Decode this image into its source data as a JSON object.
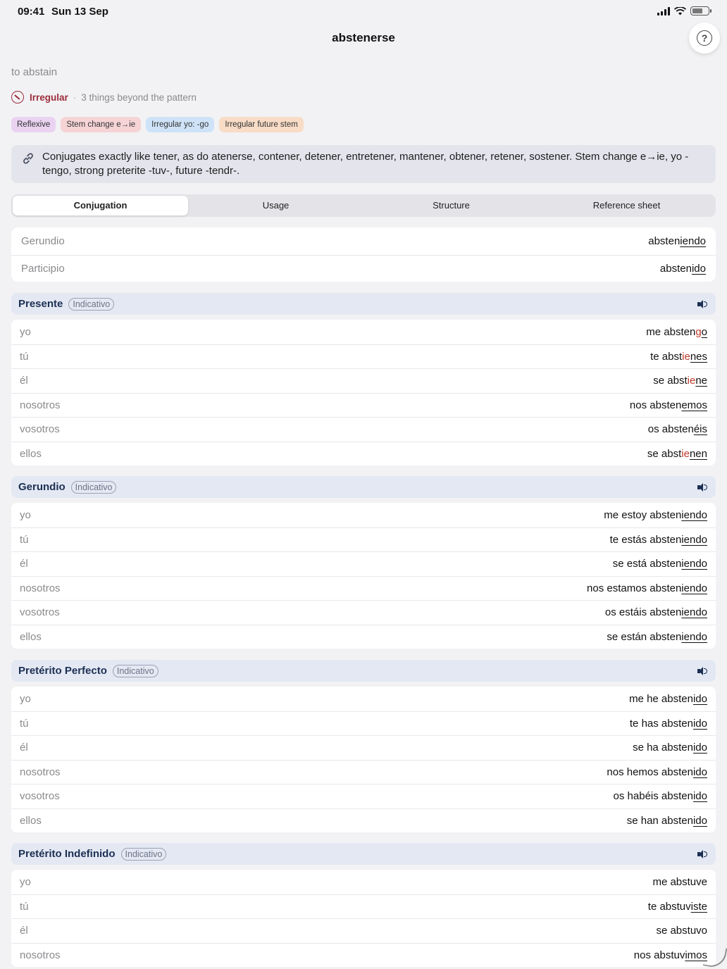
{
  "status": {
    "time": "09:41",
    "date": "Sun 13 Sep"
  },
  "nav": {
    "title": "abstenerse"
  },
  "verb": {
    "translation": "to abstain",
    "irregular_label": "Irregular",
    "irregular_note": "3 things beyond the pattern",
    "info": "Conjugates exactly like tener, as do atenerse, contener, detener, entretener, mantener, obtener, retener, sostener. Stem change e→ie, yo -tengo, strong preterite -tuv-, future -tendr-."
  },
  "tags": [
    {
      "label": "Reflexive",
      "color": "#ead2f1"
    },
    {
      "label": "Stem change e→ie",
      "color": "#f6d4d6"
    },
    {
      "label": "Irregular yo: -go",
      "color": "#cfe3f8"
    },
    {
      "label": "Irregular future stem",
      "color": "#f8dcc6"
    }
  ],
  "tabs": [
    "Conjugation",
    "Usage",
    "Structure",
    "Reference sheet"
  ],
  "forms": [
    {
      "label": "Gerundio",
      "stem": "absten",
      "ending": "iendo"
    },
    {
      "label": "Participio",
      "stem": "absten",
      "ending": "ido"
    }
  ],
  "sections": [
    {
      "title": "Presente",
      "mood": "Indicativo",
      "rows": [
        {
          "pronoun": "yo",
          "parts": [
            [
              "me absten",
              ""
            ],
            [
              "g",
              "chg"
            ],
            [
              "o",
              "end"
            ]
          ]
        },
        {
          "pronoun": "tú",
          "parts": [
            [
              "te abst",
              ""
            ],
            [
              "ie",
              "chg"
            ],
            [
              "nes",
              "end"
            ]
          ]
        },
        {
          "pronoun": "él",
          "parts": [
            [
              "se abst",
              ""
            ],
            [
              "ie",
              "chg"
            ],
            [
              "ne",
              "end"
            ]
          ]
        },
        {
          "pronoun": "nosotros",
          "parts": [
            [
              "nos absten",
              ""
            ],
            [
              "emos",
              "end"
            ]
          ]
        },
        {
          "pronoun": "vosotros",
          "parts": [
            [
              "os absten",
              ""
            ],
            [
              "éis",
              "end"
            ]
          ]
        },
        {
          "pronoun": "ellos",
          "parts": [
            [
              "se abst",
              ""
            ],
            [
              "ie",
              "chg"
            ],
            [
              "nen",
              "end"
            ]
          ]
        }
      ]
    },
    {
      "title": "Gerundio",
      "mood": "Indicativo",
      "rows": [
        {
          "pronoun": "yo",
          "parts": [
            [
              "me estoy absten",
              ""
            ],
            [
              "iendo",
              "end"
            ]
          ]
        },
        {
          "pronoun": "tú",
          "parts": [
            [
              "te estás absten",
              ""
            ],
            [
              "iendo",
              "end"
            ]
          ]
        },
        {
          "pronoun": "él",
          "parts": [
            [
              "se está absten",
              ""
            ],
            [
              "iendo",
              "end"
            ]
          ]
        },
        {
          "pronoun": "nosotros",
          "parts": [
            [
              "nos estamos absten",
              ""
            ],
            [
              "iendo",
              "end"
            ]
          ]
        },
        {
          "pronoun": "vosotros",
          "parts": [
            [
              "os estáis absten",
              ""
            ],
            [
              "iendo",
              "end"
            ]
          ]
        },
        {
          "pronoun": "ellos",
          "parts": [
            [
              "se están absten",
              ""
            ],
            [
              "iendo",
              "end"
            ]
          ]
        }
      ]
    },
    {
      "title": "Pretérito Perfecto",
      "mood": "Indicativo",
      "rows": [
        {
          "pronoun": "yo",
          "parts": [
            [
              "me he absten",
              ""
            ],
            [
              "ido",
              "end"
            ]
          ]
        },
        {
          "pronoun": "tú",
          "parts": [
            [
              "te has absten",
              ""
            ],
            [
              "ido",
              "end"
            ]
          ]
        },
        {
          "pronoun": "él",
          "parts": [
            [
              "se ha absten",
              ""
            ],
            [
              "ido",
              "end"
            ]
          ]
        },
        {
          "pronoun": "nosotros",
          "parts": [
            [
              "nos hemos absten",
              ""
            ],
            [
              "ido",
              "end"
            ]
          ]
        },
        {
          "pronoun": "vosotros",
          "parts": [
            [
              "os habéis absten",
              ""
            ],
            [
              "ido",
              "end"
            ]
          ]
        },
        {
          "pronoun": "ellos",
          "parts": [
            [
              "se han absten",
              ""
            ],
            [
              "ido",
              "end"
            ]
          ]
        }
      ]
    },
    {
      "title": "Pretérito Indefinido",
      "mood": "Indicativo",
      "rows": [
        {
          "pronoun": "yo",
          "parts": [
            [
              "me abstuve",
              ""
            ]
          ]
        },
        {
          "pronoun": "tú",
          "parts": [
            [
              "te abstuv",
              ""
            ],
            [
              "iste",
              "end"
            ]
          ]
        },
        {
          "pronoun": "él",
          "parts": [
            [
              "se abstuvo",
              ""
            ]
          ]
        },
        {
          "pronoun": "nosotros",
          "parts": [
            [
              "nos abstuv",
              ""
            ],
            [
              "imos",
              "end"
            ]
          ]
        }
      ]
    }
  ]
}
